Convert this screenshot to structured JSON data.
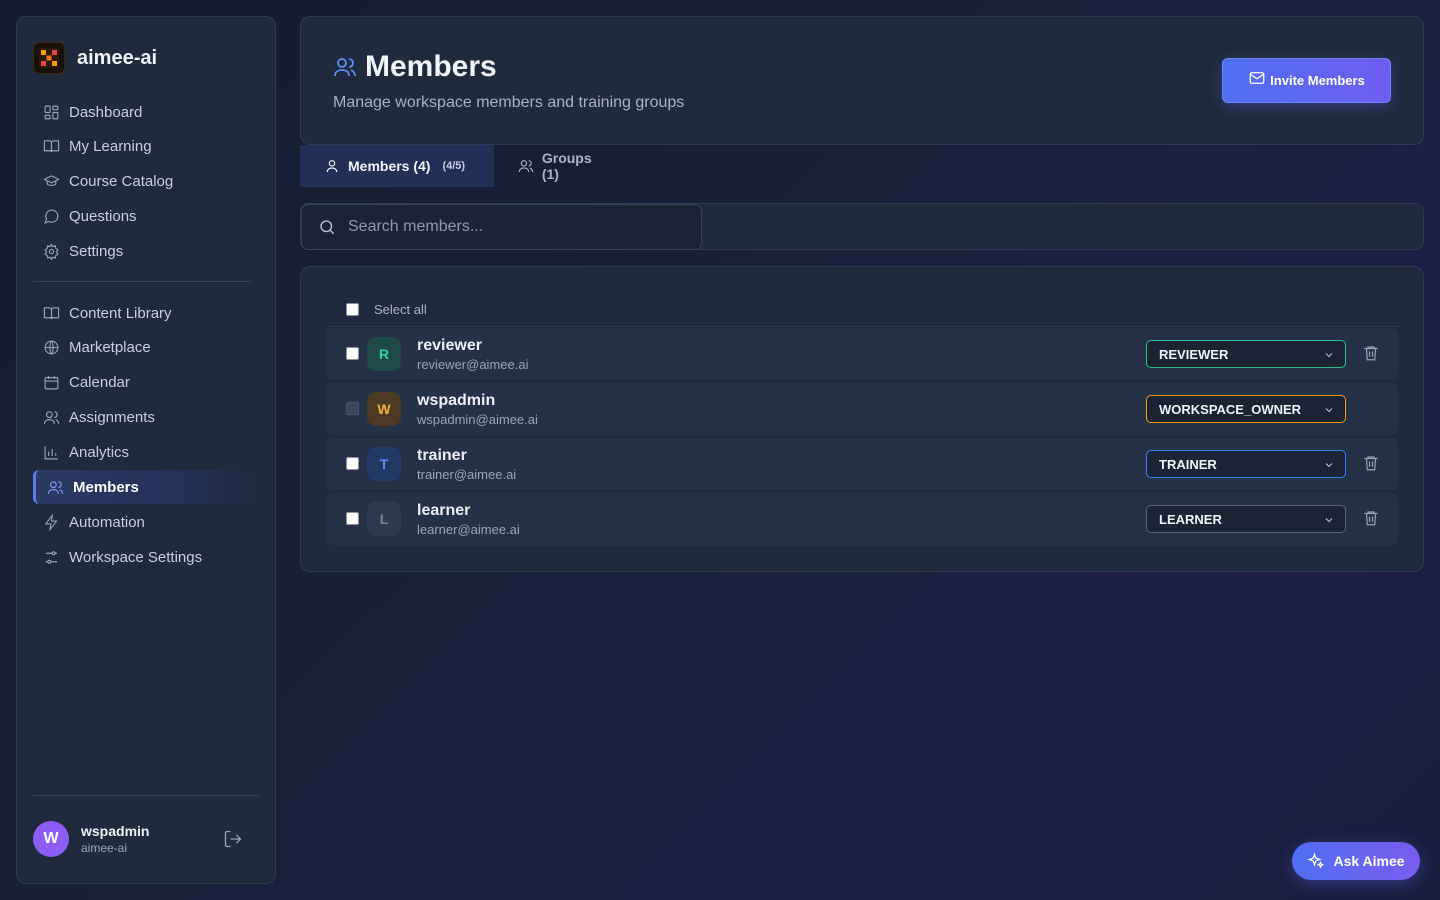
{
  "app": {
    "name": "aimee-ai"
  },
  "sidebar": {
    "primary": [
      {
        "label": "Dashboard",
        "icon": "dashboard-icon"
      },
      {
        "label": "My Learning",
        "icon": "book-icon"
      },
      {
        "label": "Course Catalog",
        "icon": "graduation-cap-icon"
      },
      {
        "label": "Questions",
        "icon": "chat-bubble-icon"
      },
      {
        "label": "Settings",
        "icon": "gear-icon"
      }
    ],
    "secondary": [
      {
        "label": "Content Library",
        "icon": "book-icon"
      },
      {
        "label": "Marketplace",
        "icon": "globe-icon"
      },
      {
        "label": "Calendar",
        "icon": "calendar-icon"
      },
      {
        "label": "Assignments",
        "icon": "users-icon"
      },
      {
        "label": "Analytics",
        "icon": "bar-chart-icon"
      },
      {
        "label": "Members",
        "icon": "users-icon",
        "active": true
      },
      {
        "label": "Automation",
        "icon": "lightning-icon"
      },
      {
        "label": "Workspace Settings",
        "icon": "sliders-icon"
      }
    ],
    "user": {
      "initial": "W",
      "name": "wspadmin",
      "org": "aimee-ai"
    }
  },
  "header": {
    "title": "Members",
    "subtitle": "Manage workspace members and training groups",
    "invite_label": "Invite Members"
  },
  "tabs": [
    {
      "label": "Members (4)",
      "count": "(4/5)",
      "active": true
    },
    {
      "label": "Groups (1)",
      "active": false
    }
  ],
  "search": {
    "placeholder": "Search members..."
  },
  "list": {
    "select_all_label": "Select all",
    "members": [
      {
        "initial": "R",
        "name": "reviewer",
        "email": "reviewer@aimee.ai",
        "role": "REVIEWER",
        "deletable": true,
        "checkbox_disabled": false,
        "accent": "#2fbf8f",
        "avatar_bg": "#1f4a45",
        "avatar_fg": "#34d399"
      },
      {
        "initial": "W",
        "name": "wspadmin",
        "email": "wspadmin@aimee.ai",
        "role": "WORKSPACE_OWNER",
        "deletable": false,
        "checkbox_disabled": true,
        "accent": "#f59e0b",
        "avatar_bg": "#4a3b22",
        "avatar_fg": "#f5b43c"
      },
      {
        "initial": "T",
        "name": "trainer",
        "email": "trainer@aimee.ai",
        "role": "TRAINER",
        "deletable": true,
        "checkbox_disabled": false,
        "accent": "#3b82f6",
        "avatar_bg": "#243a66",
        "avatar_fg": "#5b8ef7"
      },
      {
        "initial": "L",
        "name": "learner",
        "email": "learner@aimee.ai",
        "role": "LEARNER",
        "deletable": true,
        "checkbox_disabled": false,
        "accent": "#5a6478",
        "avatar_bg": "#2e3a4e",
        "avatar_fg": "#7c8698"
      }
    ]
  },
  "assistant": {
    "label": "Ask Aimee"
  }
}
